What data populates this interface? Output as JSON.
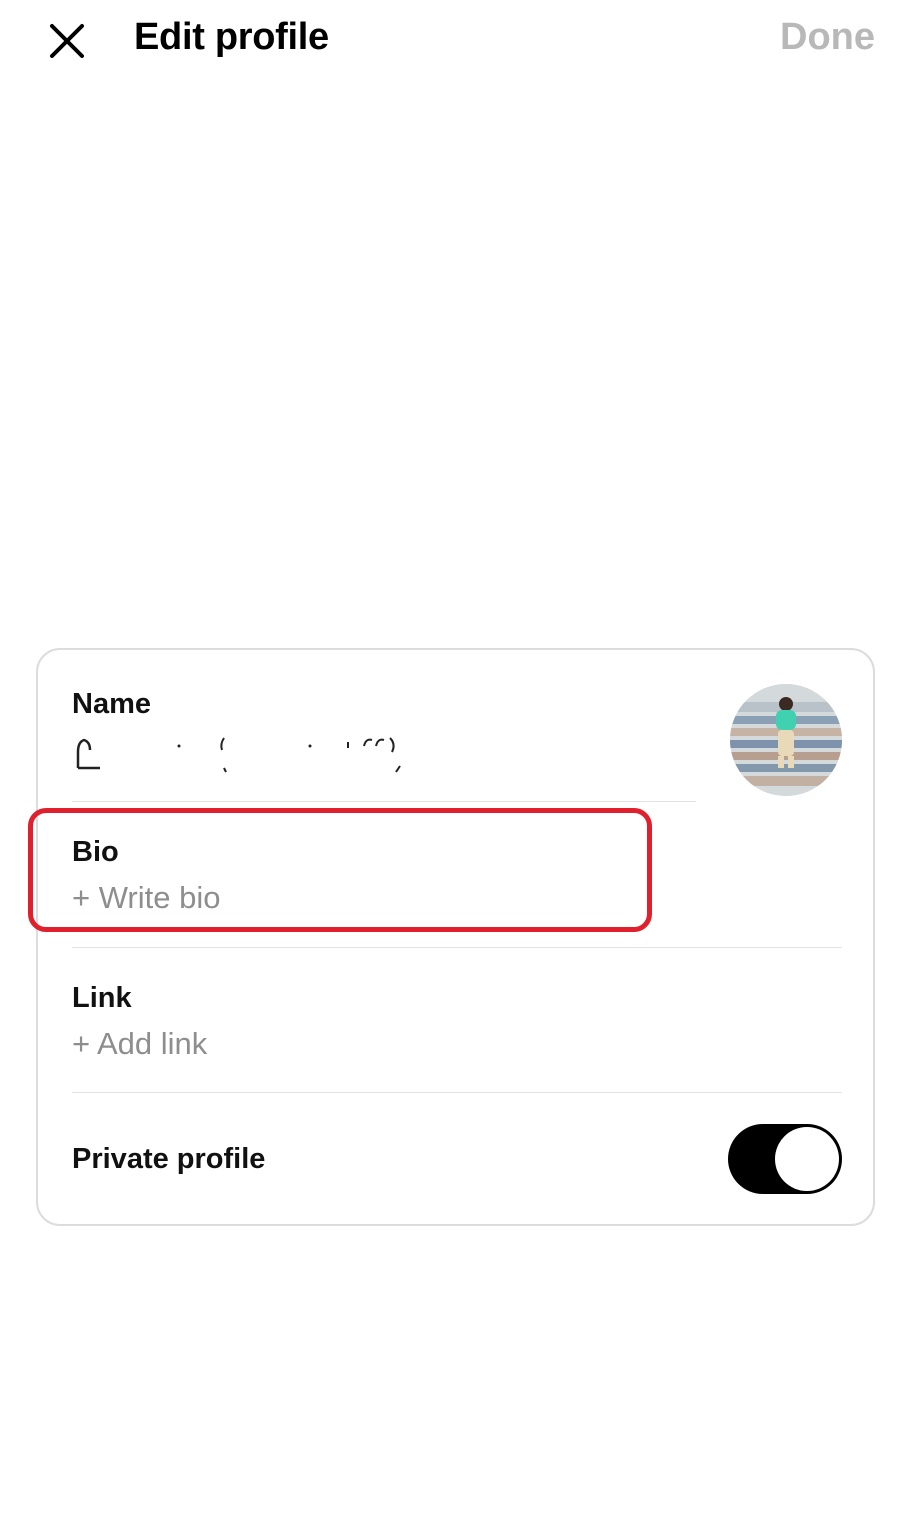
{
  "header": {
    "close_icon": "close-icon",
    "title": "Edit profile",
    "done_label": "Done",
    "done_color": "#b8b8b8"
  },
  "profile": {
    "name_label": "Name",
    "name_value": "",
    "avatar_icon": "profile-photo",
    "bio_label": "Bio",
    "bio_placeholder": "+ Write bio",
    "link_label": "Link",
    "link_placeholder": "+ Add link",
    "private_label": "Private profile",
    "private_enabled": true
  },
  "colors": {
    "highlight": "#e0202c",
    "toggle_on": "#000000",
    "placeholder": "#8e8e8e"
  }
}
